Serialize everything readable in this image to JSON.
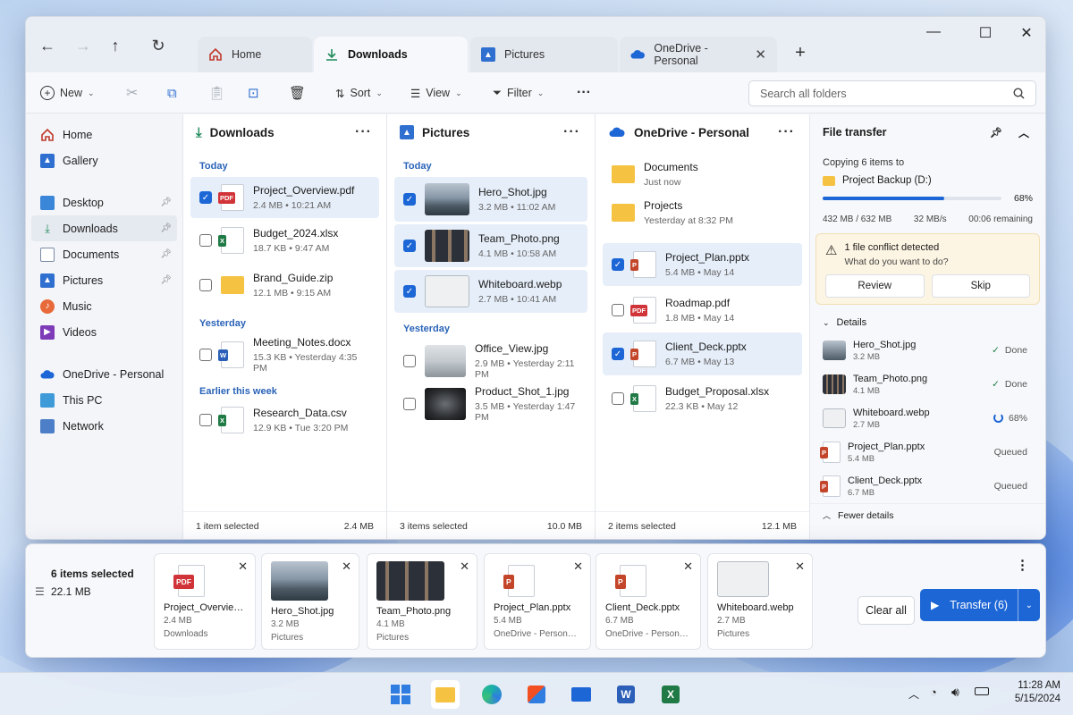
{
  "tabs": [
    {
      "label": "Home"
    },
    {
      "label": "Downloads"
    },
    {
      "label": "Pictures"
    },
    {
      "label": "OneDrive - Personal"
    }
  ],
  "toolbar": {
    "new": "New",
    "sort": "Sort",
    "view": "View",
    "filter": "Filter",
    "search_placeholder": "Search all folders"
  },
  "sidebar": {
    "items": [
      {
        "label": "Home"
      },
      {
        "label": "Gallery"
      },
      {
        "label": "Desktop"
      },
      {
        "label": "Downloads"
      },
      {
        "label": "Documents"
      },
      {
        "label": "Pictures"
      },
      {
        "label": "Music"
      },
      {
        "label": "Videos"
      },
      {
        "label": "OneDrive - Personal"
      },
      {
        "label": "This PC"
      },
      {
        "label": "Network"
      }
    ]
  },
  "downloads": {
    "title": "Downloads",
    "groups": [
      "Today",
      "Yesterday",
      "Earlier this week"
    ],
    "files": [
      {
        "name": "Project_Overview.pdf",
        "meta": "2.4 MB  •  10:21 AM"
      },
      {
        "name": "Budget_2024.xlsx",
        "meta": "18.7 KB  •  9:47 AM"
      },
      {
        "name": "Brand_Guide.zip",
        "meta": "12.1 MB  •  9:15 AM"
      },
      {
        "name": "Meeting_Notes.docx",
        "meta": "15.3 KB  •  Yesterday 4:35 PM"
      },
      {
        "name": "Research_Data.csv",
        "meta": "12.9 KB  •  Tue 3:20 PM"
      }
    ],
    "footer_left": "1 item selected",
    "footer_right": "2.4 MB"
  },
  "pictures": {
    "title": "Pictures",
    "groups": [
      "Today",
      "Yesterday"
    ],
    "files": [
      {
        "name": "Hero_Shot.jpg",
        "meta": "3.2 MB  •  11:02 AM"
      },
      {
        "name": "Team_Photo.png",
        "meta": "4.1 MB  •  10:58 AM"
      },
      {
        "name": "Whiteboard.webp",
        "meta": "2.7 MB  •  10:41 AM"
      },
      {
        "name": "Office_View.jpg",
        "meta": "2.9 MB  •  Yesterday 2:11 PM"
      },
      {
        "name": "Product_Shot_1.jpg",
        "meta": "3.5 MB  •  Yesterday 1:47 PM"
      }
    ],
    "footer_left": "3 items selected",
    "footer_right": "10.0 MB"
  },
  "onedrive": {
    "title": "OneDrive - Personal",
    "folders": [
      {
        "name": "Documents",
        "meta": "Just now"
      },
      {
        "name": "Projects",
        "meta": "Yesterday at 8:32 PM"
      }
    ],
    "files": [
      {
        "name": "Project_Plan.pptx",
        "meta": "5.4 MB  •  May 14"
      },
      {
        "name": "Roadmap.pdf",
        "meta": "1.8 MB  •  May 14"
      },
      {
        "name": "Client_Deck.pptx",
        "meta": "6.7 MB  •  May 13"
      },
      {
        "name": "Budget_Proposal.xlsx",
        "meta": "22.3 KB  •  May 12"
      }
    ],
    "footer_left": "2 items selected",
    "footer_right": "12.1 MB"
  },
  "transfer": {
    "title": "File transfer",
    "copying": "Copying 6 items to",
    "destination": "Project Backup (D:)",
    "percent": "68%",
    "progress": 0.68,
    "size_done": "432 MB / 632 MB",
    "speed": "32 MB/s",
    "remaining": "00:06 remaining",
    "conflict_title": "1 file conflict detected",
    "conflict_question": "What do you want to do?",
    "review": "Review",
    "skip": "Skip",
    "details_label": "Details",
    "details": [
      {
        "name": "Hero_Shot.jpg",
        "size": "3.2 MB",
        "status": "Done"
      },
      {
        "name": "Team_Photo.png",
        "size": "4.1 MB",
        "status": "Done"
      },
      {
        "name": "Whiteboard.webp",
        "size": "2.7 MB",
        "status": "68%"
      },
      {
        "name": "Project_Plan.pptx",
        "size": "5.4 MB",
        "status": "Queued"
      },
      {
        "name": "Client_Deck.pptx",
        "size": "6.7 MB",
        "status": "Queued"
      }
    ],
    "fewer": "Fewer details"
  },
  "basket": {
    "count": "6 items selected",
    "size": "22.1 MB",
    "items": [
      {
        "name": "Project_Overview.pdf",
        "size": "2.4 MB",
        "loc": "Downloads"
      },
      {
        "name": "Hero_Shot.jpg",
        "size": "3.2 MB",
        "loc": "Pictures"
      },
      {
        "name": "Team_Photo.png",
        "size": "4.1 MB",
        "loc": "Pictures"
      },
      {
        "name": "Project_Plan.pptx",
        "size": "5.4 MB",
        "loc": "OneDrive - Personal\\..."
      },
      {
        "name": "Client_Deck.pptx",
        "size": "6.7 MB",
        "loc": "OneDrive - Personal\\..."
      },
      {
        "name": "Whiteboard.webp",
        "size": "2.7 MB",
        "loc": "Pictures"
      }
    ],
    "clear_all": "Clear all",
    "transfer_btn": "Transfer (6)"
  },
  "taskbar": {
    "time": "11:28 AM",
    "date": "5/15/2024"
  },
  "colors": {
    "accent": "#1d66d6",
    "pdf": "#d13438",
    "excel": "#1f7a45",
    "word": "#2b5fb8",
    "ppt": "#c4462a",
    "folder": "#f5c242"
  }
}
